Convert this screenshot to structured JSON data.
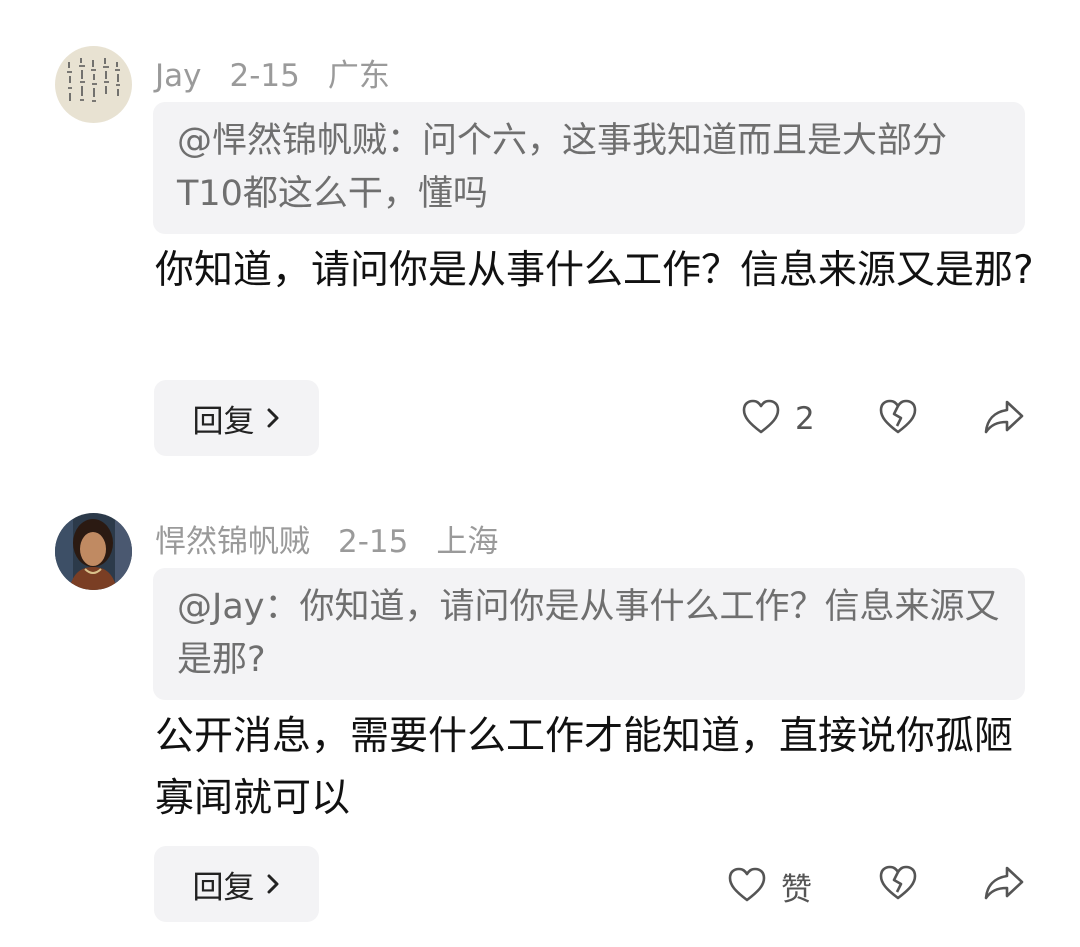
{
  "comments": [
    {
      "author": "Jay",
      "date": "2-15",
      "location": "广东",
      "quote": "@悍然锦帆贼：问个六，这事我知道而且是大部分T10都这么干，懂吗",
      "text": "你知道，请问你是从事什么工作？信息来源又是那?",
      "reply_label": "回复",
      "like_count": "2"
    },
    {
      "author": "悍然锦帆贼",
      "date": "2-15",
      "location": "上海",
      "quote": "@Jay：你知道，请问你是从事什么工作？信息来源又是那?",
      "text": "公开消息，需要什么工作才能知道，直接说你孤陋寡闻就可以",
      "reply_label": "回复",
      "like_count": "赞"
    }
  ],
  "icons": {
    "like": "heart-outline-icon",
    "dislike": "broken-heart-icon",
    "share": "share-arrow-icon",
    "chevron": "chevron-right-icon"
  },
  "colors": {
    "meta_text": "#9a9a9a",
    "quote_bg": "#f3f3f5",
    "body_text": "#111111"
  }
}
